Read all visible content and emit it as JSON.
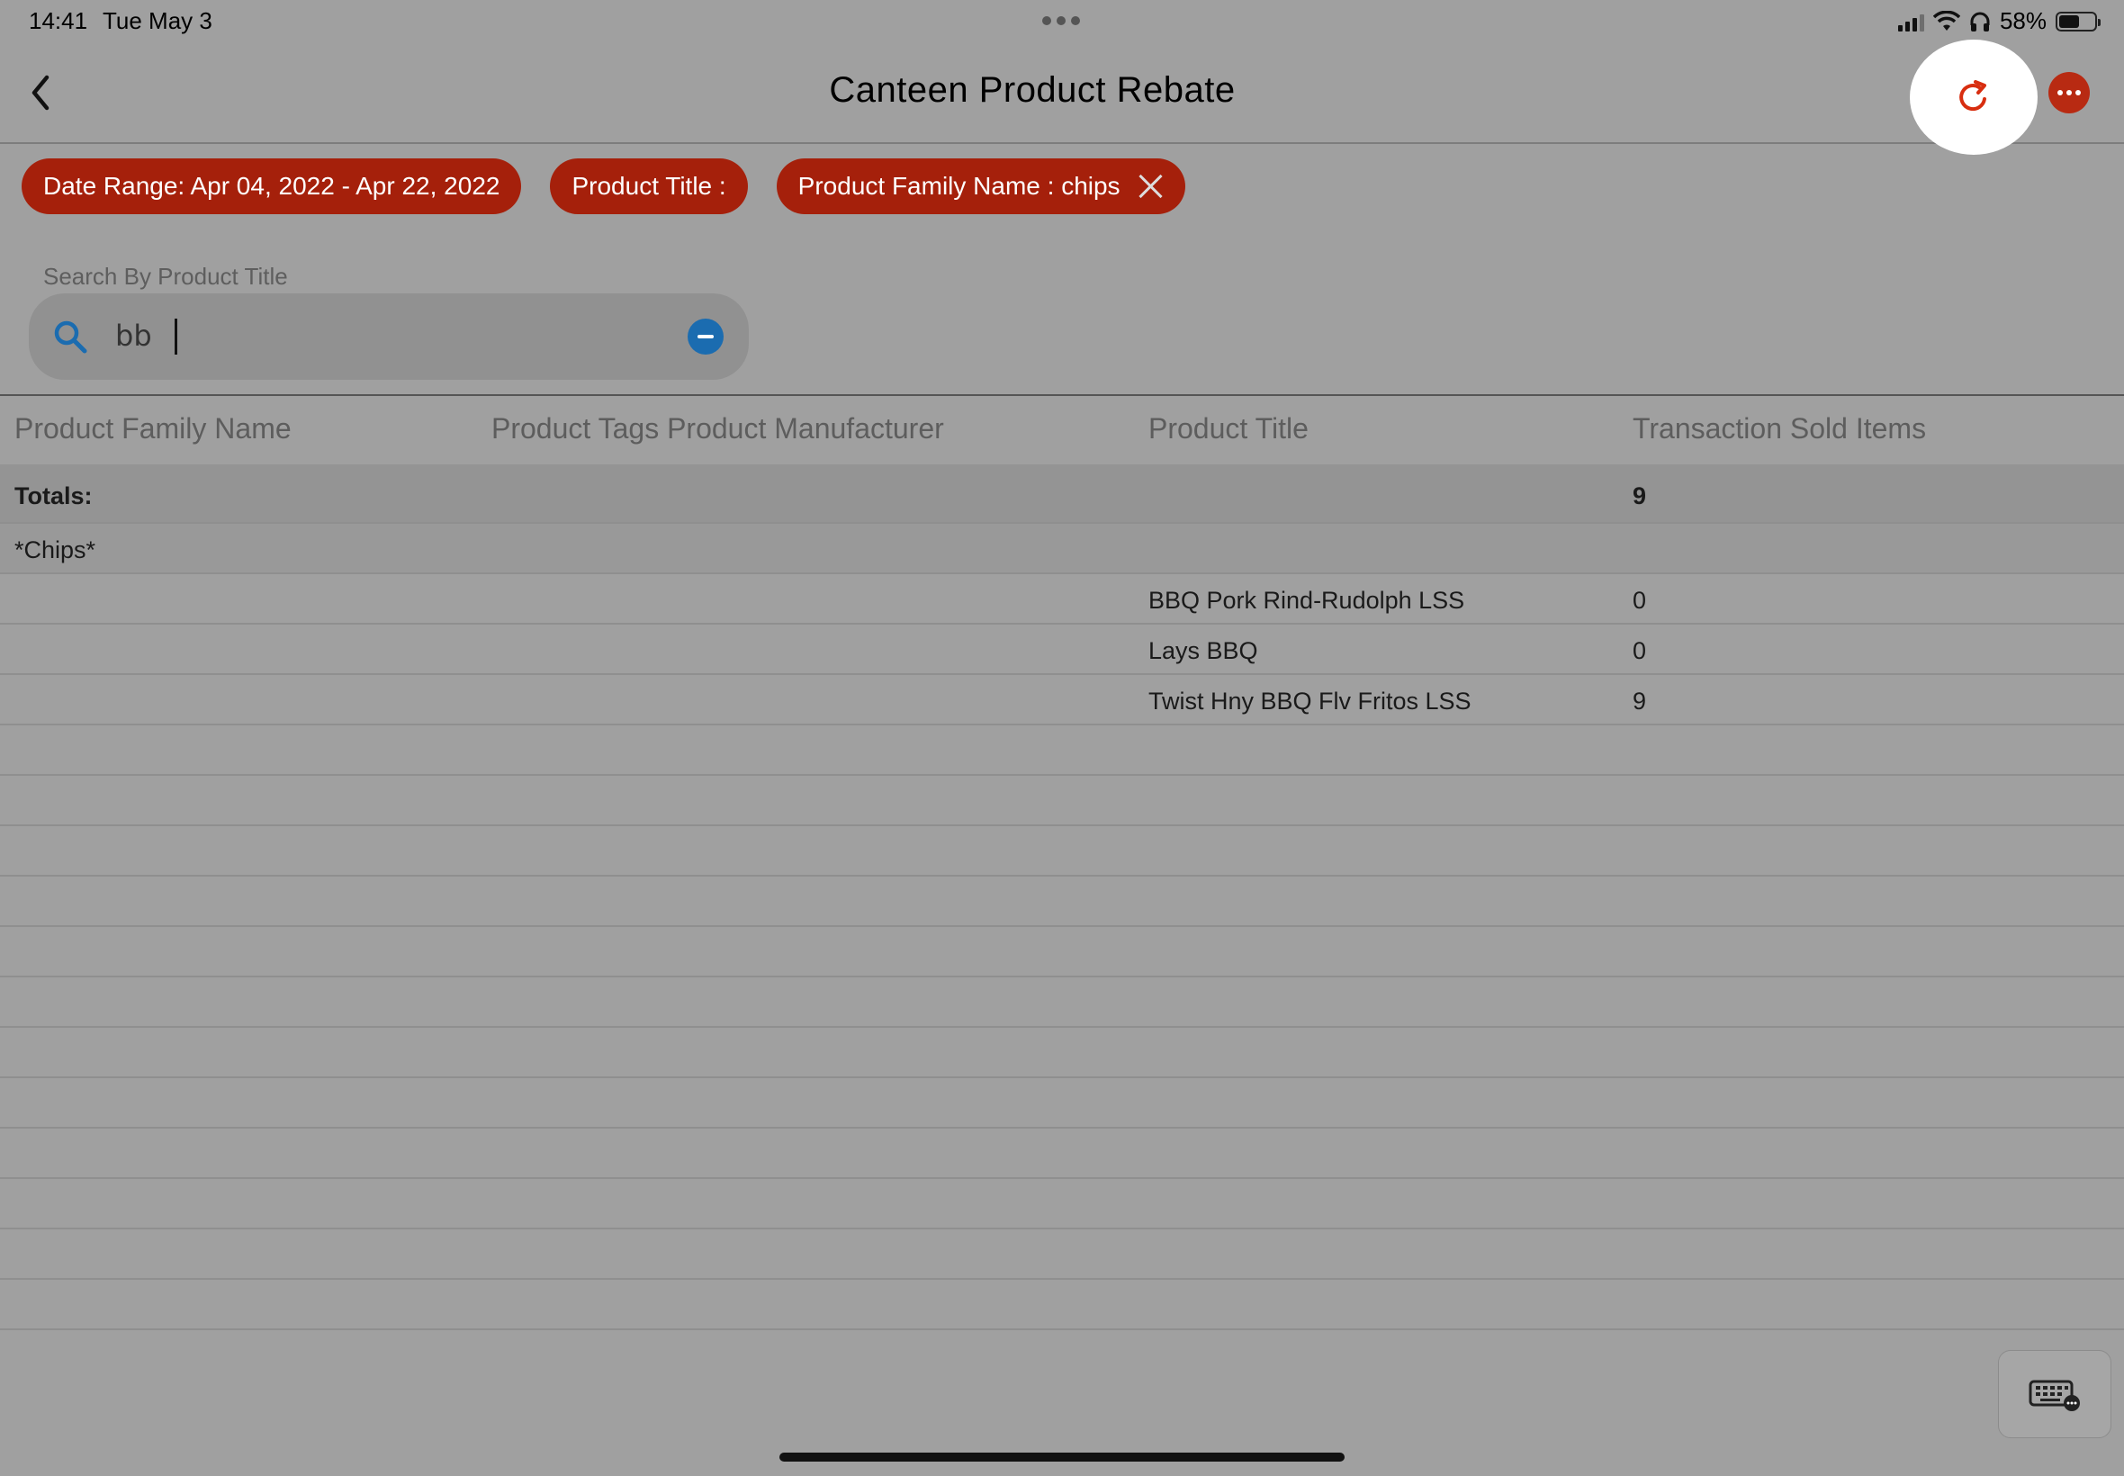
{
  "status_bar": {
    "time": "14:41",
    "date": "Tue May 3",
    "battery": "58%",
    "battery_level": 0.58
  },
  "header": {
    "title": "Canteen Product Rebate",
    "back_icon": "chevron-left-icon",
    "refresh_icon": "refresh-icon",
    "more_icon": "ellipsis-icon"
  },
  "filters": [
    {
      "label": "Date Range: Apr 04, 2022 - Apr 22, 2022",
      "removable": false
    },
    {
      "label": "Product Title :",
      "removable": false
    },
    {
      "label": "Product Family Name : chips",
      "removable": true
    }
  ],
  "search": {
    "label": "Search By Product Title",
    "value": "bb",
    "placeholder": ""
  },
  "table": {
    "columns": [
      "Product Family Name",
      "Product Tags Product Manufacturer",
      "Product Title",
      "Transaction Sold Items"
    ],
    "totals": {
      "label": "Totals:",
      "sold": "9"
    },
    "group": "*Chips*",
    "rows": [
      {
        "family": "",
        "tags": "",
        "title": "BBQ Pork Rind-Rudolph LSS",
        "sold": "0"
      },
      {
        "family": "",
        "tags": "",
        "title": "Lays BBQ",
        "sold": "0"
      },
      {
        "family": "",
        "tags": "",
        "title": "Twist Hny BBQ Flv Fritos LSS",
        "sold": "9"
      }
    ],
    "empty_rows": 12
  },
  "colors": {
    "accent": "#a5200b",
    "overlay": "#a0a0a0",
    "clear_button": "#1b6cb0",
    "highlight": "#ffffff"
  }
}
